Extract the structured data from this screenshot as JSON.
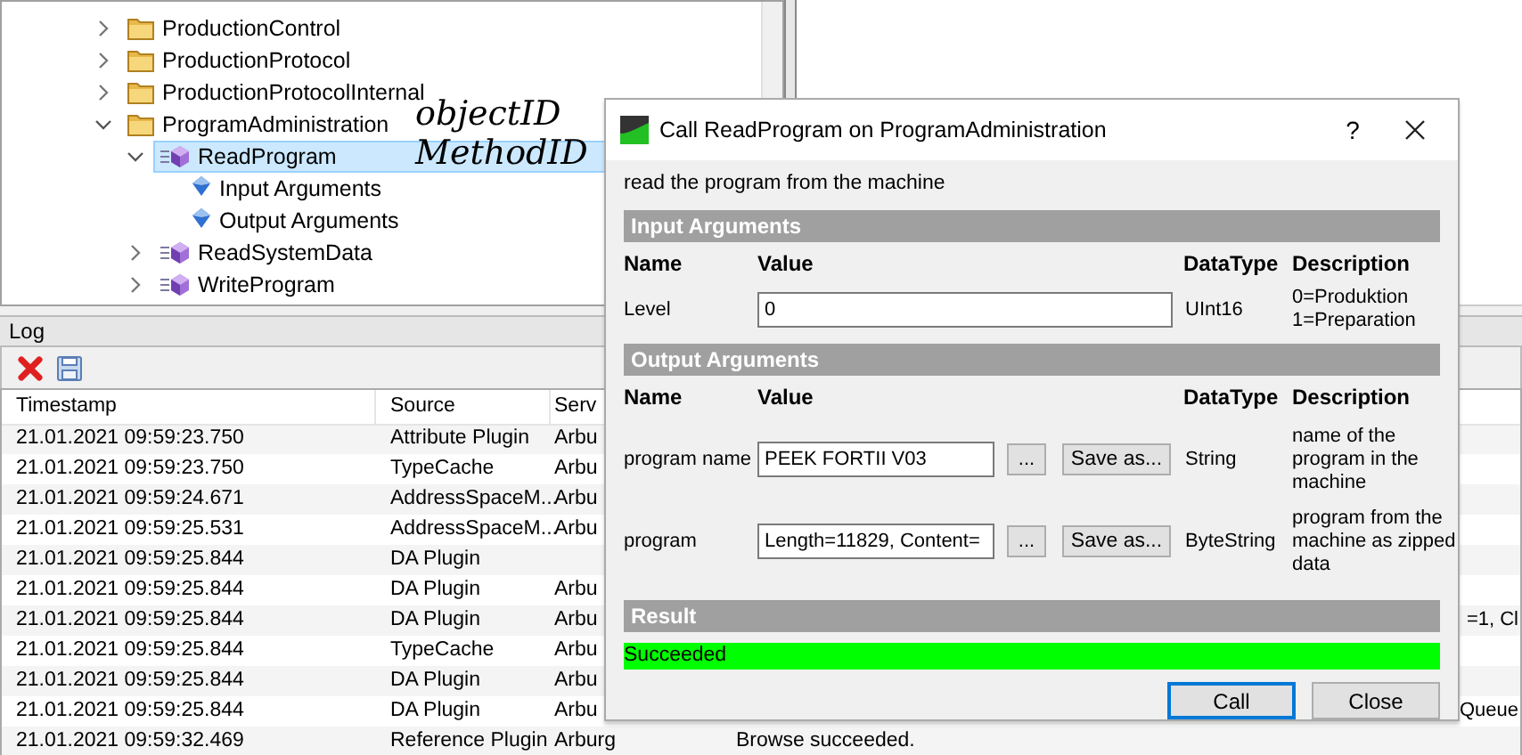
{
  "tree": {
    "items": [
      {
        "label": "ProductionControl",
        "kind": "folder",
        "expanded": false,
        "selected": false
      },
      {
        "label": "ProductionProtocol",
        "kind": "folder",
        "expanded": false,
        "selected": false
      },
      {
        "label": "ProductionProtocolInternal",
        "kind": "folder",
        "expanded": false,
        "selected": false
      },
      {
        "label": "ProgramAdministration",
        "kind": "folder",
        "expanded": true,
        "selected": false,
        "children": [
          {
            "label": "ReadProgram",
            "kind": "method",
            "expanded": true,
            "selected": true,
            "children": [
              {
                "label": "Input Arguments",
                "kind": "argument",
                "selected": false
              },
              {
                "label": "Output Arguments",
                "kind": "argument",
                "selected": false
              }
            ]
          },
          {
            "label": "ReadSystemData",
            "kind": "method",
            "expanded": false,
            "selected": false
          },
          {
            "label": "WriteProgram",
            "kind": "method",
            "expanded": false,
            "selected": false
          }
        ]
      }
    ]
  },
  "annotations": [
    "objectID",
    "MethodID"
  ],
  "log": {
    "title": "Log",
    "columns": [
      "Timestamp",
      "Source",
      "Serv"
    ],
    "rows": [
      {
        "timestamp": "21.01.2021 09:59:23.750",
        "source": "Attribute Plugin",
        "server": "Arbu"
      },
      {
        "timestamp": "21.01.2021 09:59:23.750",
        "source": "TypeCache",
        "server": "Arbu"
      },
      {
        "timestamp": "21.01.2021 09:59:24.671",
        "source": "AddressSpaceM...",
        "server": "Arbu"
      },
      {
        "timestamp": "21.01.2021 09:59:25.531",
        "source": "AddressSpaceM...",
        "server": "Arbu"
      },
      {
        "timestamp": "21.01.2021 09:59:25.844",
        "source": "DA Plugin"
      },
      {
        "timestamp": "21.01.2021 09:59:25.844",
        "source": "DA Plugin",
        "server": "Arbu"
      },
      {
        "timestamp": "21.01.2021 09:59:25.844",
        "source": "DA Plugin",
        "server": "Arbu",
        "message": "=1, Cl",
        "message_covered": true
      },
      {
        "timestamp": "21.01.2021 09:59:25.844",
        "source": "TypeCache",
        "server": "Arbu"
      },
      {
        "timestamp": "21.01.2021 09:59:25.844",
        "source": "DA Plugin",
        "server": "Arbu"
      },
      {
        "timestamp": "21.01.2021 09:59:25.844",
        "source": "DA Plugin",
        "server": "Arbu",
        "message": "Queue",
        "message_covered": true
      },
      {
        "timestamp": "21.01.2021 09:59:32.469",
        "source": "Reference Plugin",
        "server": "Arburg",
        "message": "Browse succeeded.",
        "message_covered": false
      }
    ]
  },
  "dialog": {
    "title": "Call ReadProgram on ProgramAdministration",
    "help": "?",
    "description": "read the program from the machine",
    "input_section": {
      "title": "Input Arguments",
      "columns": [
        "Name",
        "Value",
        "DataType",
        "Description"
      ],
      "rows": [
        {
          "name": "Level",
          "value": "0",
          "datatype": "UInt16",
          "description": "0=Produktion\n1=Preparation"
        }
      ]
    },
    "output_section": {
      "title": "Output Arguments",
      "columns": [
        "Name",
        "Value",
        "DataType",
        "Description"
      ],
      "rows": [
        {
          "name": "program name",
          "value": "PEEK FORTII V03",
          "browse": "...",
          "save": "Save as...",
          "datatype": "String",
          "description": "name of the\nprogram in the\nmachine"
        },
        {
          "name": "program",
          "value": "Length=11829, Content=",
          "browse": "...",
          "save": "Save as...",
          "datatype": "ByteString",
          "description": "program from the\nmachine as zipped\ndata"
        }
      ]
    },
    "result": {
      "title": "Result",
      "status": "Succeeded",
      "success": true
    },
    "buttons": [
      {
        "label": "Call",
        "default": true
      },
      {
        "label": "Close",
        "default": false
      }
    ]
  }
}
